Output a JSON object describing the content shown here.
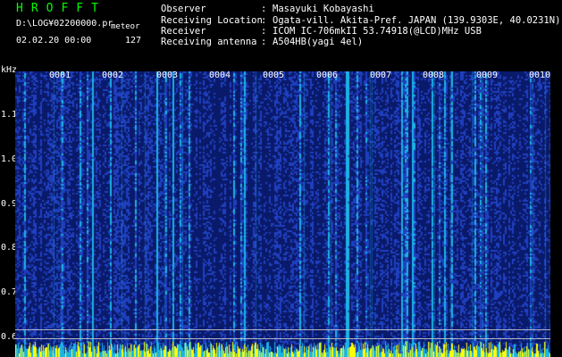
{
  "header": {
    "app_title": "HROFFT",
    "file_path": "D:\\LOG¥02200000.pr",
    "mode": "meteor",
    "datetime": "02.02.20 00:00",
    "count": "127"
  },
  "meta": [
    {
      "label": "Observer",
      "value": "Masayuki Kobayashi"
    },
    {
      "label": "Receiving Location",
      "value": "Ogata-vill. Akita-Pref. JAPAN (139.9303E, 40.0231N)"
    },
    {
      "label": "Receiver",
      "value": "ICOM IC-706mkII 53.74918(@LCD)MHz USB"
    },
    {
      "label": "Receiving antenna",
      "value": "A504HB(yagi 4el)"
    }
  ],
  "meta_separator": ":",
  "spectrogram": {
    "unit": "kHz",
    "y_ticks": [
      "1.1",
      "1.0",
      "0.9",
      "0.8",
      "0.7",
      "0.6"
    ],
    "x_ticks": [
      "0001",
      "0002",
      "0003",
      "0004",
      "0005",
      "0006",
      "0007",
      "0008",
      "0009",
      "0010"
    ],
    "colors": {
      "background": "#0a1a6a",
      "low": "#1f3fbf",
      "mid": "#19b4e6",
      "high": "#ffff00"
    }
  }
}
